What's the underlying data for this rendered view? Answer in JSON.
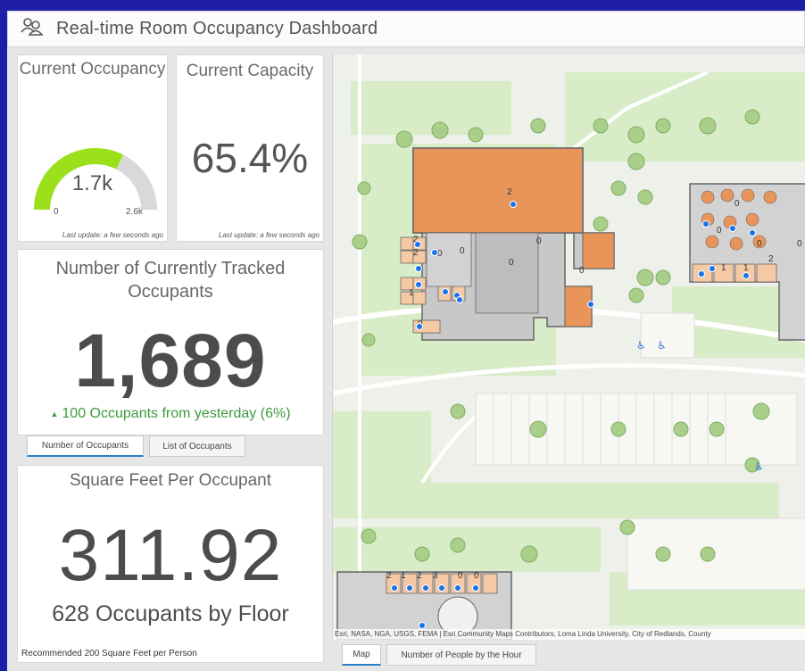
{
  "app": {
    "title": "Real-time Room Occupancy Dashboard",
    "icon": "people-icon"
  },
  "occupancy_gauge": {
    "title": "Current Occupancy",
    "value": "1.7k",
    "min": "0",
    "max": "2.6k",
    "fraction": 0.65,
    "color": "#9be01a",
    "last_update": "Last update: a few seconds ago"
  },
  "capacity": {
    "title": "Current Capacity",
    "value": "65.4%",
    "last_update": "Last update: a few seconds ago"
  },
  "tracked": {
    "title": "Number of Currently Tracked Occupants",
    "value": "1,689",
    "delta": "100 Occupants from yesterday (6%)",
    "delta_color": "#3d9b3d"
  },
  "left_tabs": [
    "Number of Occupants",
    "List of Occupants"
  ],
  "sqft": {
    "title": "Square Feet Per Occupant",
    "value": "311.92",
    "subtitle": "628 Occupants by Floor",
    "footer": "Recommended 200 Square Feet per Person"
  },
  "map": {
    "attribution": "Esri, NASA, NGA, USGS, FEMA | Esri Community Maps Contributors, Loma Linda University, City of Redlands, County",
    "room_labels": [
      "2",
      "0",
      "0",
      "0",
      "0",
      "0",
      "2",
      "2",
      "1",
      "0",
      "0",
      "0",
      "0",
      "0",
      "2",
      "1",
      "1",
      "2",
      "1",
      "2",
      "3",
      "0",
      "0"
    ],
    "colors": {
      "building_orange": "#e9955a",
      "building_light": "#f4c9a4",
      "building_gray": "#c8c8c8",
      "marker": "#1a73e8",
      "grass": "#d8ecc8"
    }
  },
  "bottom_tabs": [
    "Map",
    "Number of People by the Hour"
  ]
}
